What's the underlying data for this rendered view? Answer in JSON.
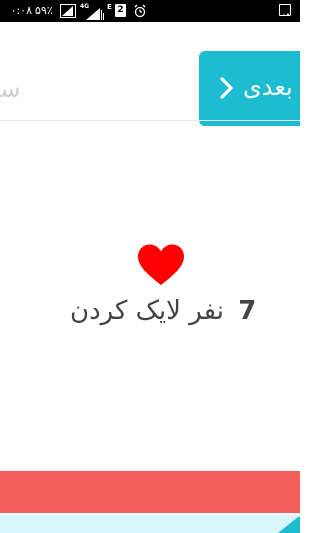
{
  "status_bar": {
    "time": "۰:۰۸",
    "battery_percent": "۵۹٪",
    "network_type": "4G",
    "carrier_letter": "E",
    "sim_slot": "2"
  },
  "navigation": {
    "prev_label": "سو",
    "next_label": "بعدی"
  },
  "likes": {
    "count": "7",
    "text": "نفر لایک کردن"
  },
  "colors": {
    "accent_teal": "#1dbcd0",
    "heart_red": "#ff0000",
    "bar_red": "#f25e5b"
  },
  "icons": {
    "heart": "heart-icon",
    "chevron": "chevron-right-icon"
  }
}
